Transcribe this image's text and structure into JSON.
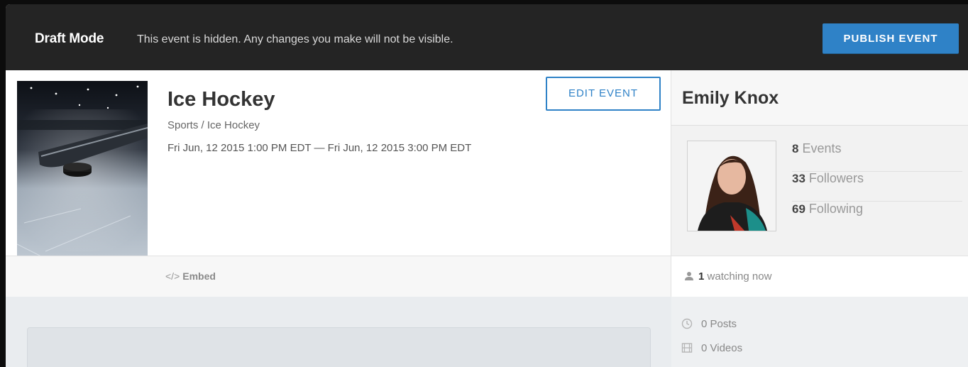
{
  "banner": {
    "mode": "Draft Mode",
    "message": "This event is hidden. Any changes you make will not be visible.",
    "publish_label": "PUBLISH EVENT",
    "accent_color": "#2f82c7"
  },
  "event": {
    "title": "Ice Hockey",
    "category": "Sports / Ice Hockey",
    "date_range": "Fri Jun, 12 2015 1:00 PM EDT — Fri Jun, 12 2015 3:00 PM EDT",
    "edit_label": "EDIT EVENT",
    "embed_icon": "</>",
    "embed_label": "Embed"
  },
  "profile": {
    "name": "Emily Knox",
    "stats": [
      {
        "value": "8",
        "label": "Events"
      },
      {
        "value": "33",
        "label": "Followers"
      },
      {
        "value": "69",
        "label": "Following"
      }
    ],
    "watching_count": "1",
    "watching_label": "watching now"
  },
  "activity": {
    "posts": "0 Posts",
    "videos": "0 Videos"
  }
}
